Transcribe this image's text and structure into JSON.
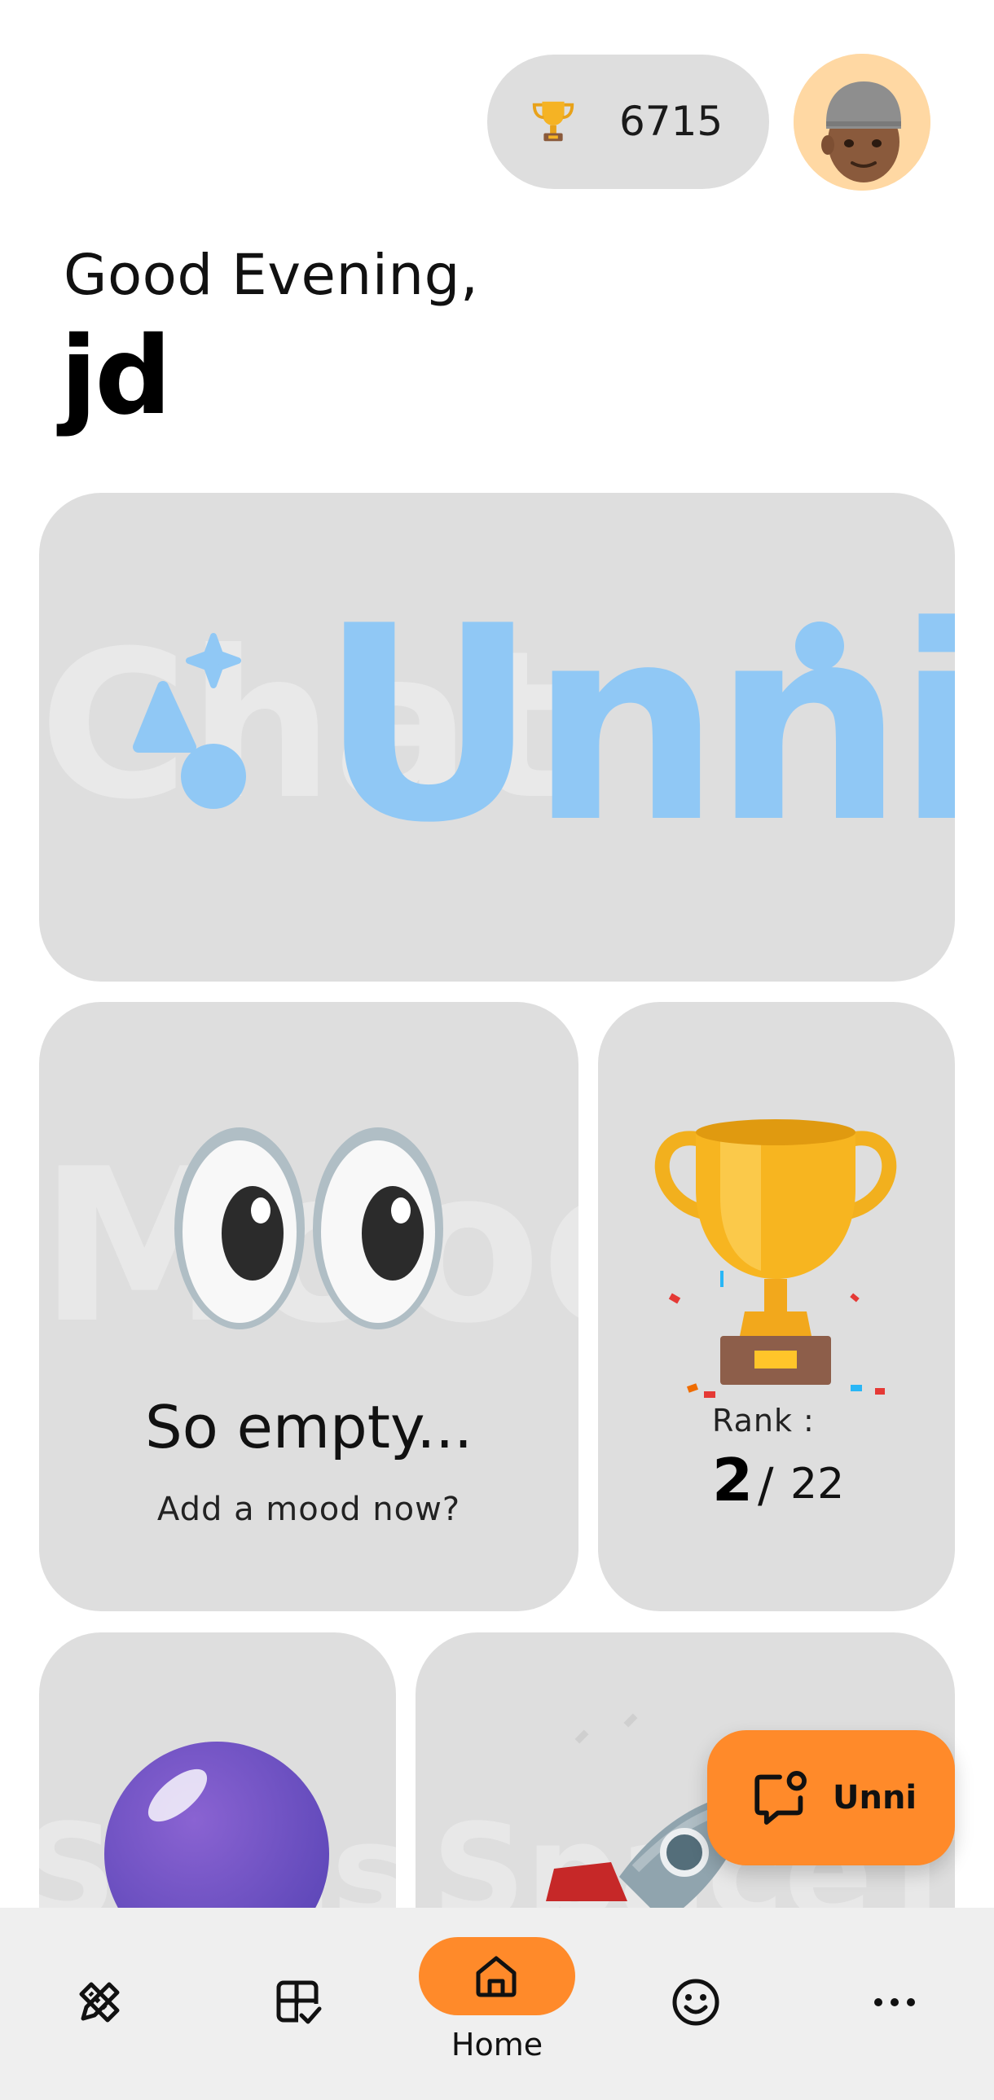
{
  "header": {
    "points_value": "6715",
    "trophy_icon": "trophy-icon",
    "avatar_icon": "memoji-avatar"
  },
  "greeting": {
    "line": "Good Evening,",
    "name": "jd"
  },
  "banner": {
    "brand": "Unni",
    "brand_color": "#90c8f5"
  },
  "mood": {
    "title": "So empty...",
    "subtitle": "Add a mood now?",
    "watermark": "MoodRoom"
  },
  "rank": {
    "label": "Rank :",
    "value": "2",
    "separator": "/",
    "total": "22"
  },
  "cards_row3": {
    "ball_watermark": "StressBall",
    "rocket_watermark": "SpaceTrek"
  },
  "fab": {
    "label": "Unni",
    "color": "#ff8a2a",
    "icon": "chat-bubble-person-icon"
  },
  "nav": {
    "items": [
      {
        "name": "tools",
        "icon": "pencil-ruler-icon"
      },
      {
        "name": "tasks",
        "icon": "grid-check-icon"
      },
      {
        "name": "home",
        "label": "Home",
        "icon": "home-icon",
        "active": true
      },
      {
        "name": "mood",
        "icon": "smiley-icon"
      },
      {
        "name": "more",
        "icon": "more-dots-icon"
      }
    ],
    "active_color": "#ff8a2a"
  }
}
